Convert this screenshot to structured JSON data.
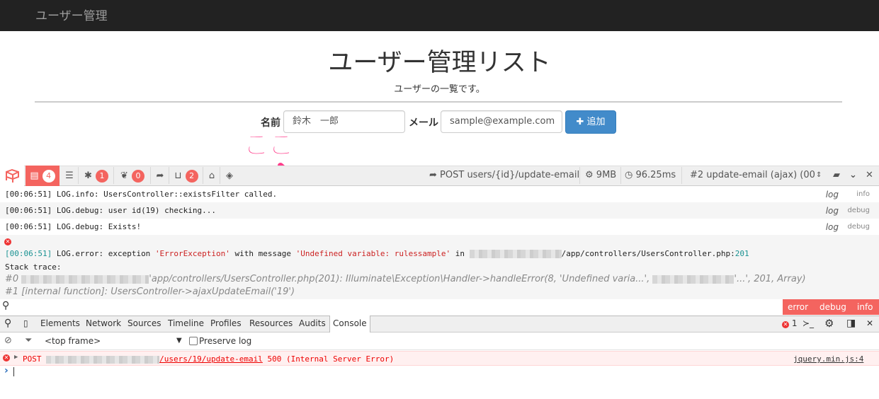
{
  "navbar": {
    "brand": "ユーザー管理"
  },
  "page": {
    "title": "ユーザー管理リスト",
    "subtitle": "ユーザーの一覧です。"
  },
  "form": {
    "name_label": "名前",
    "name_value": "鈴木　一郎",
    "email_label": "メール",
    "email_placeholder": "sample@example.com",
    "add_label": "追加"
  },
  "annotation": {
    "text": "ここ"
  },
  "debugbar": {
    "tabs": [
      {
        "icon": "list-icon",
        "count": "4"
      },
      {
        "icon": "bars-icon"
      },
      {
        "icon": "bug-icon",
        "count": "1"
      },
      {
        "icon": "leaf-icon",
        "count": "0"
      },
      {
        "icon": "share-icon"
      },
      {
        "icon": "inbox-icon",
        "count": "2"
      },
      {
        "icon": "drive-icon"
      },
      {
        "icon": "tags-icon"
      }
    ],
    "request": "POST users/{id}/update-email",
    "memory": "9MB",
    "time": "96.25ms",
    "dataset": "#2 update-email (ajax) (00",
    "logs": [
      {
        "time": "[00:06:51]",
        "text": " LOG.info: UsersController::existsFilter called.",
        "label": "log",
        "level": "info"
      },
      {
        "time": "[00:06:51]",
        "text": " LOG.debug: user id(19) checking...",
        "label": "log",
        "level": "debug"
      },
      {
        "time": "[00:06:51]",
        "text": " LOG.debug: Exists!",
        "label": "log",
        "level": "debug"
      }
    ],
    "error": {
      "time": "[00:06:51]",
      "prefix": " LOG.error: exception ",
      "exception": "'ErrorException'",
      "mid": " with message ",
      "message": "'Undefined variable: rulessample'",
      "in": " in ",
      "path": "/app/controllers/UsersController.php:",
      "line": "201",
      "stack_label": "Stack trace:",
      "trace0a": "#0 ",
      "trace0b": "'app/controllers/UsersController.php(201): Illuminate\\Exception\\Handler->handleError(8, 'Undefined varia...', ",
      "trace0c": "'...', 201, Array)",
      "trace1": "#1 [internal function]: UsersController->ajaxUpdateEmail('19')"
    },
    "filters": [
      "error",
      "debug",
      "info"
    ]
  },
  "devtools": {
    "tabs": [
      "Elements",
      "Network",
      "Sources",
      "Timeline",
      "Profiles",
      "Resources",
      "Audits",
      "Console"
    ],
    "error_count": "1",
    "frame": "<top frame>",
    "preserve_log": "Preserve log",
    "console_error": {
      "method": "POST",
      "path": "/users/19/update-email",
      "status": "500 (Internal Server Error)",
      "source": "jquery.min.js:4"
    },
    "prompt": "›"
  }
}
